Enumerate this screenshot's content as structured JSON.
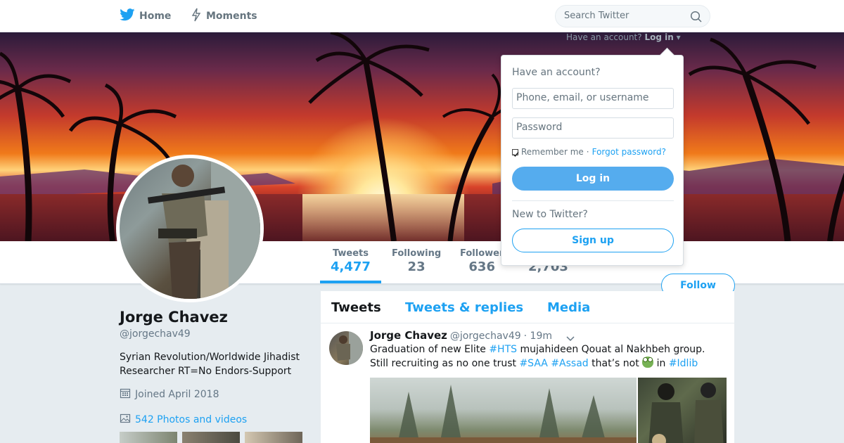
{
  "nav": {
    "home_label": "Home",
    "moments_label": "Moments",
    "search_placeholder": "Search Twitter"
  },
  "login_hint": {
    "text": "Have an account?",
    "link": "Log in"
  },
  "login_dropdown": {
    "title": "Have an account?",
    "username_placeholder": "Phone, email, or username",
    "password_placeholder": "Password",
    "remember_label": "Remember me",
    "separator": "·",
    "forgot_label": "Forgot password?",
    "login_button": "Log in",
    "new_label": "New to Twitter?",
    "signup_button": "Sign up"
  },
  "profile": {
    "name": "Jorge Chavez",
    "handle": "@jorgechav49",
    "bio_line1": "Syrian Revolution/Worldwide Jihadist",
    "bio_line2": "Researcher RT=No Endors-Support",
    "joined": "Joined April 2018",
    "photos_link": "542 Photos and videos",
    "follow_button": "Follow"
  },
  "stats": [
    {
      "label": "Tweets",
      "value": "4,477"
    },
    {
      "label": "Following",
      "value": "23"
    },
    {
      "label": "Follower",
      "value": "636"
    },
    {
      "label": "",
      "value": "2,703"
    }
  ],
  "timeline": {
    "tabs": [
      "Tweets",
      "Tweets & replies",
      "Media"
    ],
    "tweet": {
      "name": "Jorge Chavez",
      "handle": "@jorgechav49",
      "time": "· 19m",
      "line1_a": "Graduation of new Elite ",
      "tag_hts": "#HTS",
      "line1_b": " mujahideen Qouat al Nakhbeh group.",
      "line2_a": "Still recruiting as no one trust ",
      "tag_saa": "#SAA",
      "tag_assad": "#Assad",
      "line2_b": " that’s not ",
      "line2_c": " in ",
      "tag_idlib": "#Idlib"
    }
  },
  "colors": {
    "accent": "#1da1f2",
    "login_button": "#55acee",
    "muted_text": "#657786",
    "background": "#e6ecf0"
  },
  "icons": {
    "home": "bird-icon",
    "moments": "lightning-icon",
    "search": "search-icon",
    "calendar": "calendar-icon",
    "photos": "image-icon",
    "caret": "chevron-down-icon"
  }
}
